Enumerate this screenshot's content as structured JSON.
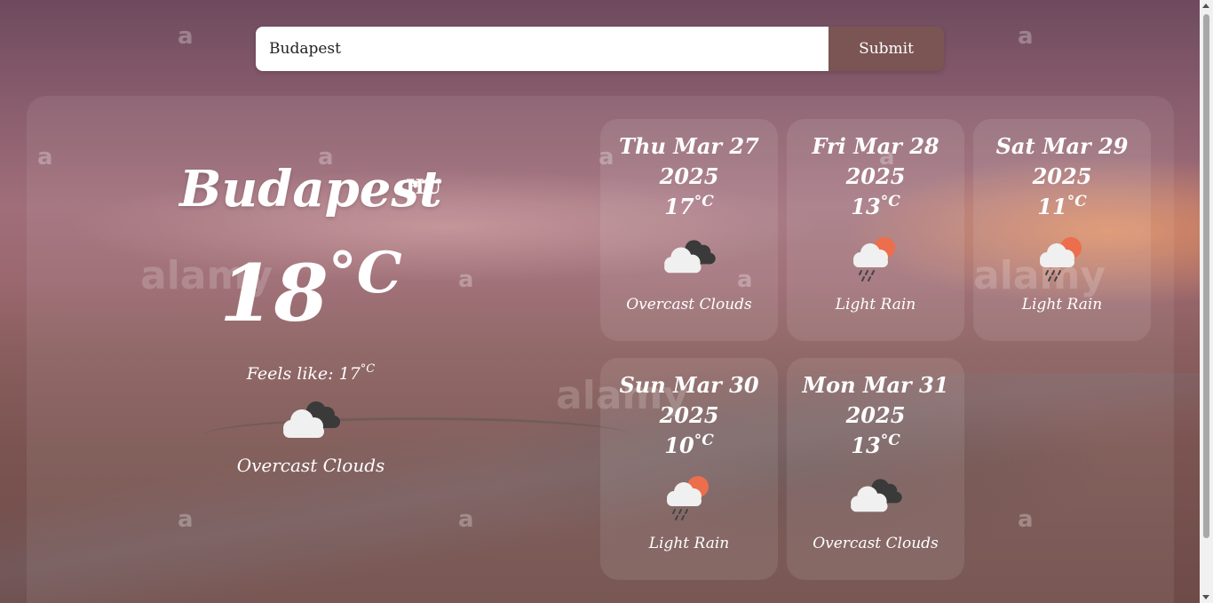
{
  "search": {
    "value": "Budapest",
    "submit_label": "Submit"
  },
  "current": {
    "city": "Budapest",
    "country": "HU",
    "temp": "18",
    "temp_unit": "°C",
    "feels_label": "Feels like:",
    "feels_value": "17",
    "feels_unit": "°C",
    "icon": "overcast-clouds-icon",
    "description": "Overcast Clouds"
  },
  "forecast": [
    {
      "date": "Thu Mar 27",
      "year": "2025",
      "temp": "17",
      "unit": "°C",
      "icon": "overcast-clouds-icon",
      "description": "Overcast Clouds"
    },
    {
      "date": "Fri Mar 28",
      "year": "2025",
      "temp": "13",
      "unit": "°C",
      "icon": "light-rain-icon",
      "description": "Light Rain"
    },
    {
      "date": "Sat Mar 29",
      "year": "2025",
      "temp": "11",
      "unit": "°C",
      "icon": "light-rain-icon",
      "description": "Light Rain"
    },
    {
      "date": "Sun Mar 30",
      "year": "2025",
      "temp": "10",
      "unit": "°C",
      "icon": "light-rain-icon",
      "description": "Light Rain"
    },
    {
      "date": "Mon Mar 31",
      "year": "2025",
      "temp": "13",
      "unit": "°C",
      "icon": "overcast-clouds-icon",
      "description": "Overcast Clouds"
    }
  ],
  "colors": {
    "submit_bg": "#7a5553",
    "sun": "#ec6e4c",
    "dark_cloud": "#3a3a3a",
    "light_cloud": "#f0f0f0"
  },
  "watermark": {
    "small": "a",
    "large": "alamy"
  }
}
